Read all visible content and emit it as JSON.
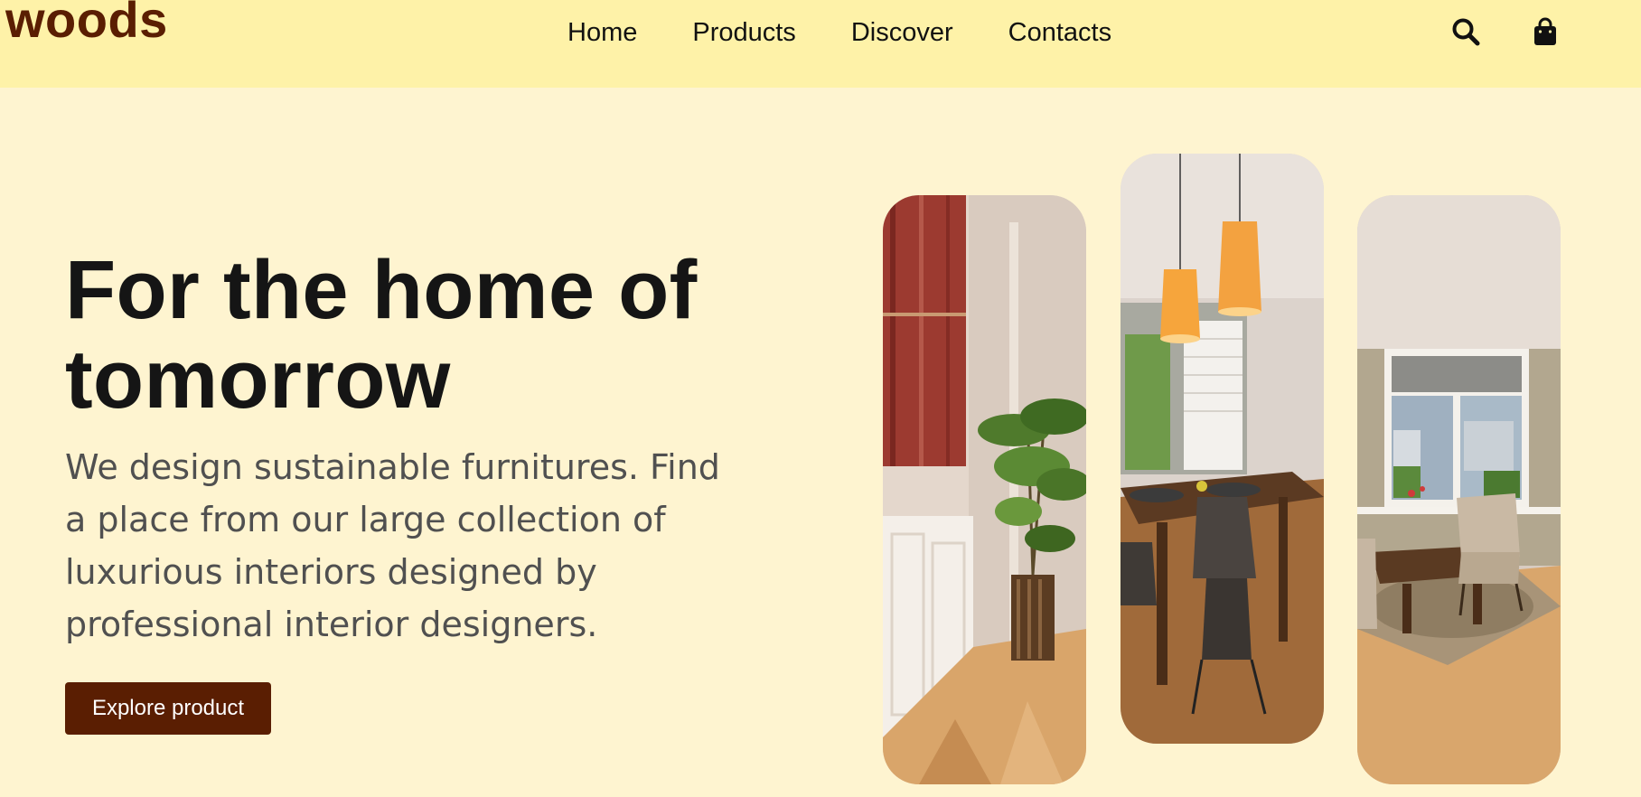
{
  "brand": {
    "logo_text": "woods"
  },
  "nav": {
    "links": [
      "Home",
      "Products",
      "Discover",
      "Contacts"
    ],
    "icons": [
      "search-icon",
      "shopping-bag-icon"
    ]
  },
  "hero": {
    "title_line1": "For the home of",
    "title_line2": "tomorrow",
    "description": "We design sustainable furnitures. Find a place from our large collection of luxurious interiors designed by professional interior designers.",
    "cta_label": "Explore product"
  },
  "gallery": {
    "images": [
      "hallway-plant-photo",
      "dining-room-pendant-lamps-photo",
      "living-room-window-photo"
    ]
  },
  "colors": {
    "nav_background": "#fef2a8",
    "page_background": "#fef4d0",
    "brand_brown": "#5a1e02",
    "title_text": "#151515",
    "body_text": "#505050"
  }
}
